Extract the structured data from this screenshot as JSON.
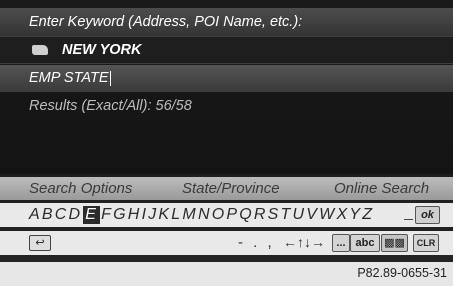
{
  "header": {
    "prompt": "Enter Keyword (Address, POI Name, etc.):"
  },
  "state": {
    "name": "NEW YORK",
    "flag_icon": "us-flag-icon"
  },
  "input": {
    "value": "EMP STATE"
  },
  "results": {
    "label": "Results (Exact/All): 56/58"
  },
  "options": {
    "search_options": "Search Options",
    "state_province": "State/Province",
    "online_search": "Online Search"
  },
  "keyboard": {
    "letters": [
      "A",
      "B",
      "C",
      "D",
      "E",
      "F",
      "G",
      "H",
      "I",
      "J",
      "K",
      "L",
      "M",
      "N",
      "O",
      "P",
      "Q",
      "R",
      "S",
      "T",
      "U",
      "V",
      "W",
      "X",
      "Y",
      "Z"
    ],
    "selected": "E",
    "ok": "ok"
  },
  "controls": {
    "punctuation": "- . ,",
    "arrows": "←↑↓→",
    "more": "...",
    "abc": "abc",
    "clr": "CLR",
    "back_icon": "back-icon",
    "special_chars_icon": "special-chars-icon"
  },
  "caption": "P82.89-0655-31"
}
